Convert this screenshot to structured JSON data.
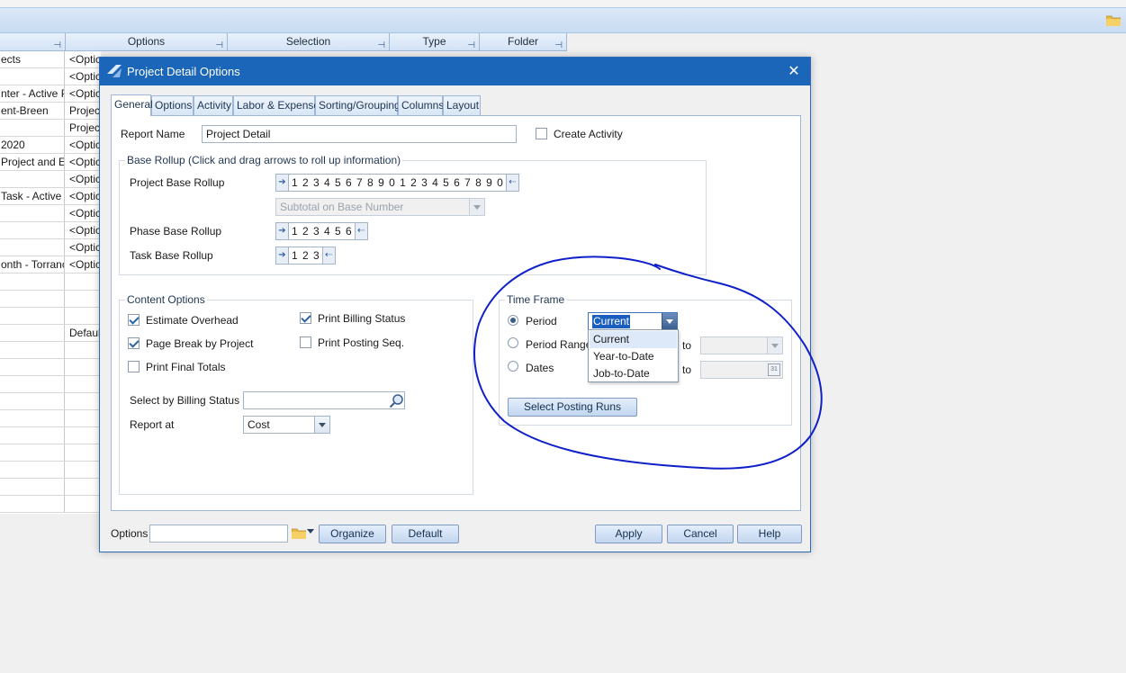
{
  "background": {
    "grid_headers": [
      {
        "label": ""
      },
      {
        "label": "Options"
      },
      {
        "label": "Selection"
      },
      {
        "label": "Type"
      },
      {
        "label": "Folder"
      }
    ],
    "rows": [
      {
        "name": "ects",
        "option": "<Optic"
      },
      {
        "name": "",
        "option": "<Optic"
      },
      {
        "name": "nter - Active P",
        "option": "<Optic"
      },
      {
        "name": "ent-Breen",
        "option": "Projec"
      },
      {
        "name": "",
        "option": "Projec"
      },
      {
        "name": " 2020",
        "option": "<Optic"
      },
      {
        "name": " Project and E",
        "option": "<Optic"
      },
      {
        "name": "",
        "option": "<Optic"
      },
      {
        "name": "Task - Active",
        "option": "<Optic"
      },
      {
        "name": "",
        "option": "<Optic"
      },
      {
        "name": "",
        "option": "<Optic"
      },
      {
        "name": "",
        "option": "<Optic"
      },
      {
        "name": "onth - Torranc",
        "option": "<Optic"
      },
      {
        "name": "",
        "option": ""
      },
      {
        "name": "",
        "option": ""
      },
      {
        "name": "",
        "option": ""
      },
      {
        "name": "",
        "option": "Defaul"
      },
      {
        "name": "",
        "option": ""
      },
      {
        "name": "",
        "option": ""
      },
      {
        "name": "",
        "option": ""
      },
      {
        "name": "",
        "option": ""
      },
      {
        "name": "",
        "option": ""
      },
      {
        "name": "",
        "option": ""
      },
      {
        "name": "",
        "option": ""
      },
      {
        "name": "",
        "option": ""
      },
      {
        "name": "",
        "option": ""
      },
      {
        "name": "",
        "option": ""
      }
    ]
  },
  "dialog": {
    "title": "Project Detail Options",
    "close_glyph": "✕",
    "tabs": [
      "General",
      "Options",
      "Activity",
      "Labor & Expense",
      "Sorting/Grouping",
      "Columns",
      "Layout"
    ],
    "active_tab": "General",
    "report_name_label": "Report Name",
    "report_name_value": "Project Detail",
    "create_activity_label": "Create Activity",
    "create_activity_checked": false,
    "base_rollup": {
      "title": "Base Rollup (Click and drag arrows to roll up information)",
      "project_label": "Project Base Rollup",
      "project_digits": "1 2 3 4 5 6 7 8 9 0 1 2 3 4 5 6 7 8 9 0",
      "subtotal_placeholder": "Subtotal on Base Number",
      "phase_label": "Phase Base Rollup",
      "phase_digits": "1 2 3 4 5 6",
      "task_label": "Task Base Rollup",
      "task_digits": "1 2 3"
    },
    "content_options": {
      "title": "Content Options",
      "estimate_overhead": {
        "label": "Estimate Overhead",
        "checked": true
      },
      "page_break": {
        "label": "Page Break by Project",
        "checked": true
      },
      "print_final_totals": {
        "label": "Print Final Totals",
        "checked": false
      },
      "print_billing_status": {
        "label": "Print Billing Status",
        "checked": true
      },
      "print_posting_seq": {
        "label": "Print Posting Seq.",
        "checked": false
      },
      "billing_status_label": "Select by Billing Status",
      "billing_status_value": "",
      "report_at_label": "Report at",
      "report_at_value": "Cost"
    },
    "time_frame": {
      "title": "Time Frame",
      "period_label": "Period",
      "period_range_label": "Period Range",
      "dates_label": "Dates",
      "to_label": "to",
      "period_value": "Current",
      "period_options": [
        "Current",
        "Year-to-Date",
        "Job-to-Date"
      ],
      "selected_radio": "Period",
      "select_posting_runs": "Select Posting Runs",
      "calendar_day": "31"
    },
    "footer": {
      "options_label": "Options",
      "options_value": "",
      "organize": "Organize",
      "default": "Default",
      "apply": "Apply",
      "cancel": "Cancel",
      "help": "Help"
    }
  },
  "colors": {
    "titlebar": "#1b66b8",
    "annotation": "#1020c8"
  }
}
